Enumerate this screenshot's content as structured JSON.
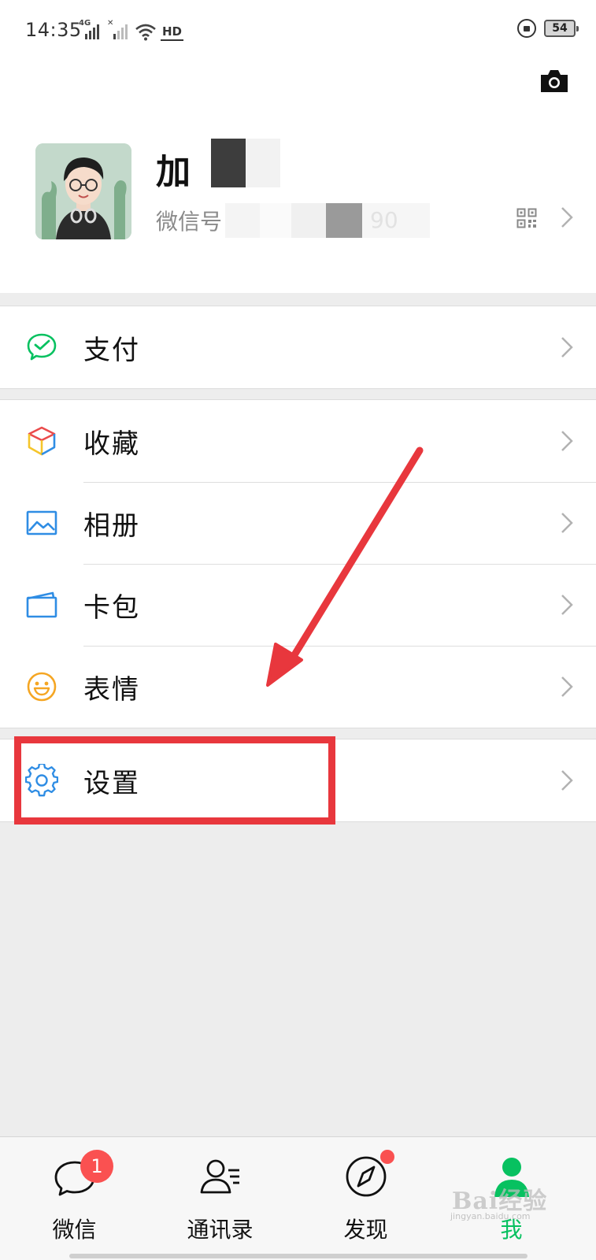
{
  "status_bar": {
    "time": "14:35",
    "network_type": "4G",
    "hd_label": "HD",
    "battery_level": "54"
  },
  "profile": {
    "nickname": "加",
    "wechat_id_label": "微信号",
    "wechat_id_suffix": "90"
  },
  "menu": {
    "pay": {
      "label": "支付",
      "icon": "wechat-pay-icon",
      "color": "#07c160"
    },
    "items": [
      {
        "label": "收藏",
        "icon": "favorites-cube-icon"
      },
      {
        "label": "相册",
        "icon": "photo-album-icon",
        "color": "#2f8de4"
      },
      {
        "label": "卡包",
        "icon": "card-wallet-icon",
        "color": "#2f8de4"
      },
      {
        "label": "表情",
        "icon": "sticker-smile-icon",
        "color": "#f5a623"
      }
    ],
    "settings": {
      "label": "设置",
      "icon": "gear-icon",
      "color": "#2f8de4"
    }
  },
  "annotation": {
    "highlight_color": "#e8373d",
    "target": "设置"
  },
  "tab_bar": {
    "tabs": [
      {
        "label": "微信",
        "icon": "chat-bubble-icon",
        "badge": "1"
      },
      {
        "label": "通讯录",
        "icon": "contacts-icon"
      },
      {
        "label": "发现",
        "icon": "compass-icon",
        "dot": true
      },
      {
        "label": "我",
        "icon": "me-person-icon",
        "active": true
      }
    ],
    "active_color": "#07c160"
  },
  "watermark": {
    "brand": "Bai经验",
    "url": "jingyan.baidu.com"
  }
}
